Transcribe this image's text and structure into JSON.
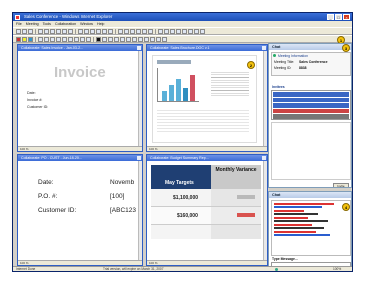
{
  "window": {
    "title": "Sales Conference - Windows Internet Explorer"
  },
  "menu": {
    "items": [
      "File",
      "Meeting",
      "Tools",
      "Collaboration",
      "Window",
      "Help"
    ]
  },
  "callouts": {
    "toolbar": "1",
    "doc2": "2",
    "chat": "3",
    "chat2": "4"
  },
  "documents": {
    "doc1": {
      "title": "Collaborate: Sales Invoice - Jan-03-2...",
      "invoice_word": "Invoice",
      "labels": [
        "Date:",
        "Invoice #:",
        "Customer ID:"
      ],
      "zoom": "100 %"
    },
    "doc2": {
      "title": "Collaborate: Sales Brochure.DOC v.1",
      "zoom": "100 %"
    },
    "doc3": {
      "title": "Collaborate: PO - CUST - Jun-18-20...",
      "date_label": "Date:",
      "date_value": "Novemb",
      "po_label": "P.O. #:",
      "po_value": "[100]",
      "cust_label": "Customer ID:",
      "cust_value": "[ABC123",
      "zoom": "100 %"
    },
    "doc4": {
      "title": "Collaborate: Budget Summary Rep...",
      "col1_header": "May Targets",
      "col2_header": "Monthly Variance",
      "row1_value": "$1,100,000",
      "row2_value": "$160,000",
      "zoom": "100 %"
    }
  },
  "chat_panel": {
    "header": "Chat",
    "section_meeting": "Meeting Information",
    "meeting_title_label": "Meeting Title:",
    "meeting_title_value": "Sales Conference",
    "meeting_id_label": "Meeting ID:",
    "meeting_id_value": "8838",
    "invitees_header": "Invitees",
    "invite_button": "Invite"
  },
  "chat2_panel": {
    "header": "Chat",
    "type_label": "Type Message..."
  },
  "status": {
    "left": "Internet Done",
    "middle": "Trial version, will expire on March 31, 2007",
    "right": "100%"
  }
}
